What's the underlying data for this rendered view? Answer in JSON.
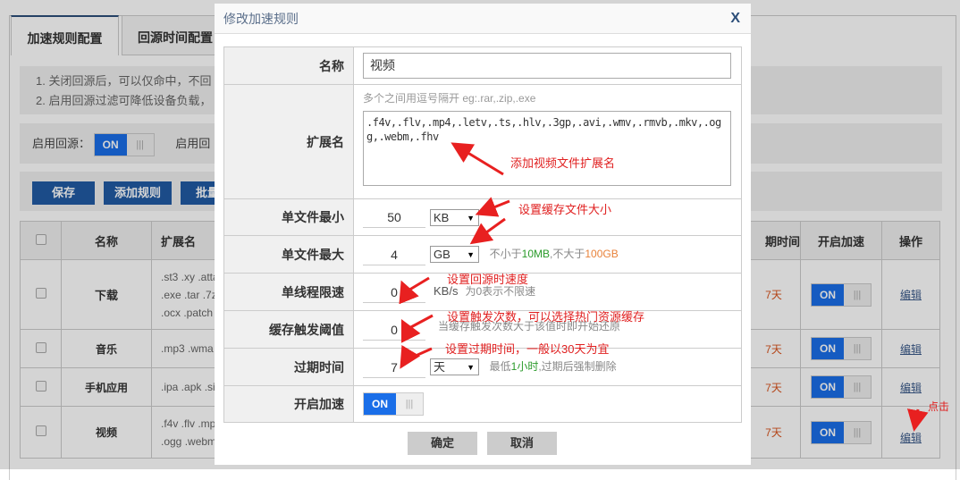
{
  "page": {
    "tabs": [
      {
        "label": "加速规则配置",
        "active": true
      },
      {
        "label": "回源时间配置",
        "active": false
      }
    ],
    "info_lines": [
      "1. 关闭回源后，可以仅命中，不回",
      "2. 启用回源过滤可降低设备负载，"
    ],
    "toggle_label": "启用回源：",
    "toggle_state": "ON",
    "toggle_label2": "启用回",
    "buttons": {
      "save": "保存",
      "add_rule": "添加规则",
      "batch": "批量"
    },
    "table": {
      "headers": {
        "name": "名称",
        "ext": "扩展名",
        "expire": "期时间",
        "enable": "开启加速",
        "action": "操作"
      },
      "rows": [
        {
          "name": "下载",
          "ext": [
            ".st3 .xy .atta",
            ".exe .tar .7z",
            ".ocx .patch"
          ],
          "expire": "7天",
          "enable": "ON",
          "action": "编辑"
        },
        {
          "name": "音乐",
          "ext": [
            ".mp3 .wma"
          ],
          "expire": "7天",
          "enable": "ON",
          "action": "编辑"
        },
        {
          "name": "手机应用",
          "ext": [
            ".ipa .apk .si"
          ],
          "expire": "7天",
          "enable": "ON",
          "action": "编辑"
        },
        {
          "name": "视频",
          "ext": [
            ".f4v .flv .mp",
            ".ogg .webm"
          ],
          "expire": "7天",
          "enable": "ON",
          "action": "编辑"
        }
      ]
    },
    "click_note": "点击"
  },
  "modal": {
    "title": "修改加速规则",
    "close": "X",
    "name_label": "名称",
    "name_value": "视频",
    "ext_label": "扩展名",
    "ext_hint": "多个之间用逗号隔开 eg:.rar,.zip,.exe",
    "ext_value": ".f4v,.flv,.mp4,.letv,.ts,.hlv,.3gp,.avi,.wmv,.rmvb,.mkv,.ogg,.webm,.fhv",
    "min_label": "单文件最小",
    "min_value": "50",
    "min_unit": "KB",
    "max_label": "单文件最大",
    "max_value": "4",
    "max_unit": "GB",
    "max_hint": {
      "a": "不小于",
      "b": "10MB",
      "c": ",不大于",
      "d": "100GB"
    },
    "speed_label": "单线程限速",
    "speed_value": "0",
    "speed_unit": "KB/s",
    "speed_hint": "为0表示不限速",
    "threshold_label": "缓存触发阈值",
    "threshold_value": "0",
    "threshold_hint": "当缓存触发次数大于该值时即开始还原",
    "expire_label": "过期时间",
    "expire_value": "7",
    "expire_unit": "天",
    "expire_hint": {
      "a": "最低",
      "b": "1小时",
      "c": ",过期后强制删除"
    },
    "enable_label": "开启加速",
    "enable_state": "ON",
    "ok": "确定",
    "cancel": "取消"
  },
  "annotations": {
    "ext": "添加视频文件扩展名",
    "size": "设置缓存文件大小",
    "speed": "设置回源时速度",
    "threshold": "设置触发次数，可以选择热门资源缓存",
    "expire": "设置过期时间，一般以30天为宜"
  },
  "colors": {
    "accent": "#1a6ee8",
    "button": "#215ba4",
    "annotation": "#e02020",
    "green": "#2a9a2a",
    "orange": "#e8823a"
  }
}
